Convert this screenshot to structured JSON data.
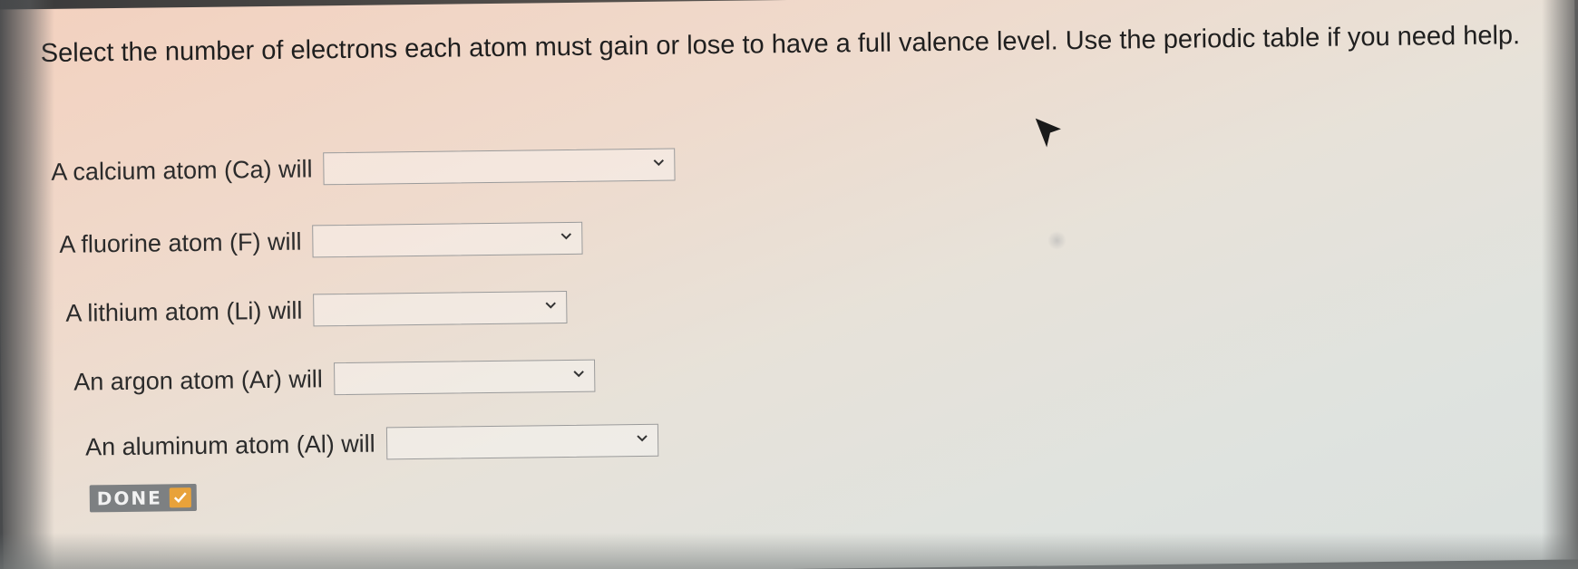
{
  "question": {
    "text": "Select the number of electrons each atom must gain or lose to have a full valence level. Use the periodic table if you need help."
  },
  "items": [
    {
      "label": "A calcium atom (Ca) will",
      "selected": ""
    },
    {
      "label": "A fluorine atom (F) will",
      "selected": ""
    },
    {
      "label": "A lithium atom (Li) will",
      "selected": ""
    },
    {
      "label": "An argon atom (Ar) will",
      "selected": ""
    },
    {
      "label": "An aluminum atom (Al) will",
      "selected": ""
    }
  ],
  "done_button": {
    "label": "DONE",
    "icon": "checkmark-icon",
    "check_color": "#e8a23a"
  },
  "colors": {
    "background_warm": "#f3d1bf",
    "background_cool": "#dbe0de",
    "text": "#2b2b2b"
  }
}
